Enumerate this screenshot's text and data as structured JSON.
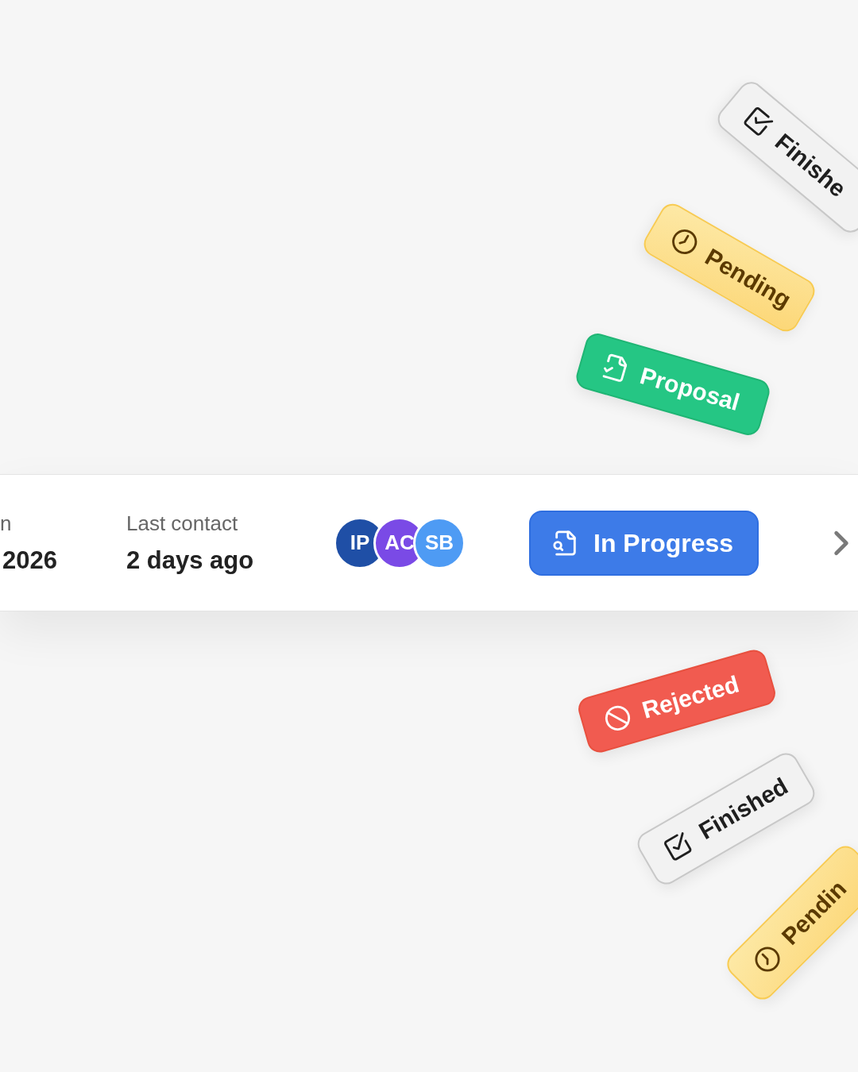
{
  "record": {
    "fields": [
      {
        "label": "n",
        "value": "2026"
      },
      {
        "label": "Last contact",
        "value": "2 days ago"
      }
    ],
    "participants": [
      {
        "initials": "IP",
        "color": "#1f4fa6"
      },
      {
        "initials": "AC",
        "color": "#7a4ae6"
      },
      {
        "initials": "SB",
        "color": "#4e9bf4"
      }
    ],
    "status": {
      "kind": "in_progress",
      "label": "In Progress"
    }
  },
  "status_badges": [
    {
      "kind": "finished",
      "label": "Finishe"
    },
    {
      "kind": "pending",
      "label": "Pending"
    },
    {
      "kind": "proposal",
      "label": "Proposal"
    },
    {
      "kind": "rejected",
      "label": "Rejected"
    },
    {
      "kind": "finished",
      "label": "Finished"
    },
    {
      "kind": "pending",
      "label": "Pendin"
    }
  ]
}
